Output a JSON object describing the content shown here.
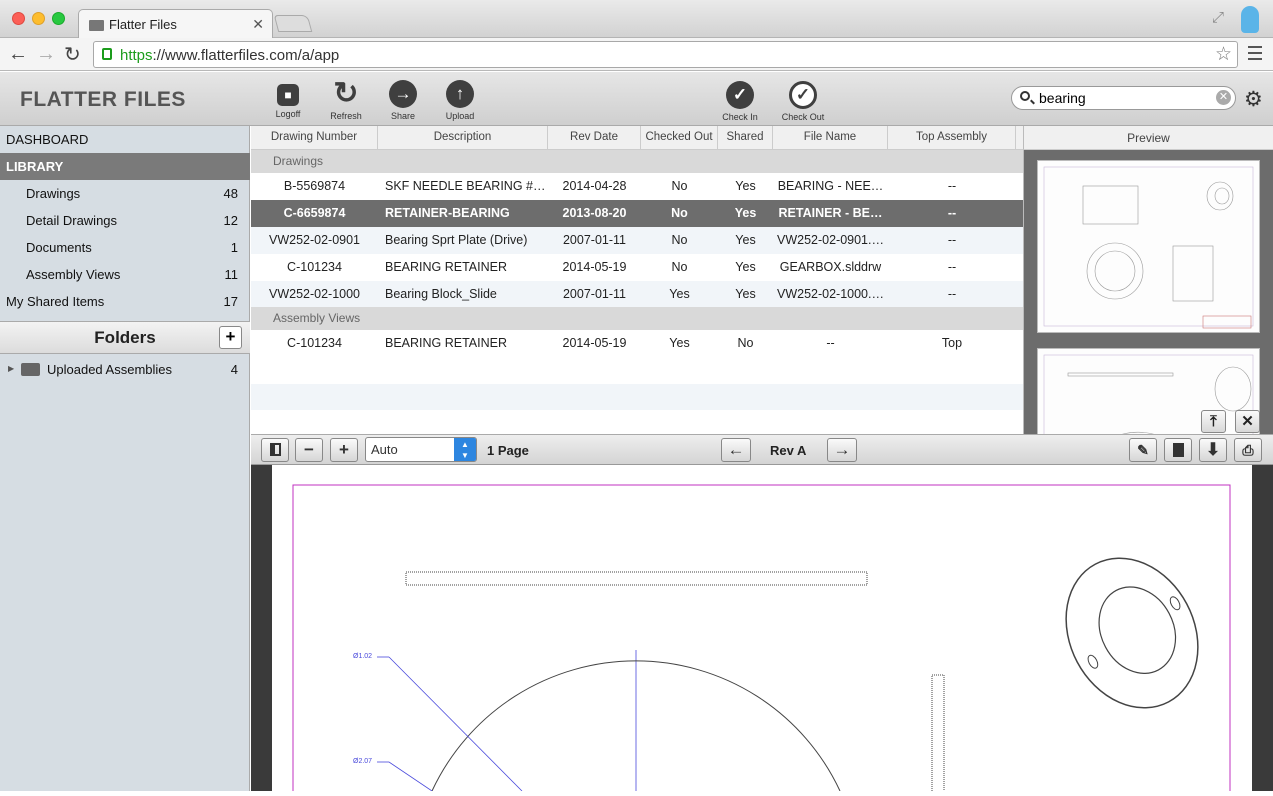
{
  "browser": {
    "tab_title": "Flatter Files",
    "url_https": "https",
    "url_rest": "://www.flatterfiles.com/a/app"
  },
  "app": {
    "logo": "FLATTER FILES",
    "toolbar": {
      "logoff": "Logoff",
      "refresh": "Refresh",
      "share": "Share",
      "upload": "Upload",
      "check_in": "Check In",
      "check_out": "Check Out"
    },
    "search": {
      "value": "bearing"
    }
  },
  "sidebar": {
    "dashboard": "DASHBOARD",
    "library": "LIBRARY",
    "items": [
      {
        "label": "Drawings",
        "count": "48"
      },
      {
        "label": "Detail Drawings",
        "count": "12"
      },
      {
        "label": "Documents",
        "count": "1"
      },
      {
        "label": "Assembly Views",
        "count": "11"
      }
    ],
    "shared": {
      "label": "My Shared Items",
      "count": "17"
    },
    "folders_title": "Folders",
    "folders_add": "+",
    "folders": [
      {
        "label": "Uploaded Assemblies",
        "count": "4"
      }
    ]
  },
  "table": {
    "headers": [
      "Drawing Number",
      "Description",
      "Rev Date",
      "Checked Out",
      "Shared",
      "File Name",
      "Top Assembly"
    ],
    "groups": [
      "Drawings",
      "Assembly Views"
    ],
    "drawings": [
      [
        "B-5569874",
        "SKF NEEDLE BEARING #…",
        "2014-04-28",
        "No",
        "Yes",
        "BEARING - NEE…",
        "--"
      ],
      [
        "C-6659874",
        "RETAINER-BEARING",
        "2013-08-20",
        "No",
        "Yes",
        "RETAINER - BE…",
        "--"
      ],
      [
        "VW252-02-0901",
        "Bearing Sprt  Plate (Drive)",
        "2007-01-11",
        "No",
        "Yes",
        "VW252-02-0901.…",
        "--"
      ],
      [
        "C-101234",
        "BEARING RETAINER",
        "2014-05-19",
        "No",
        "Yes",
        "GEARBOX.slddrw",
        "--"
      ],
      [
        "VW252-02-1000",
        "Bearing Block_Slide",
        "2007-01-11",
        "Yes",
        "Yes",
        "VW252-02-1000.…",
        "--"
      ]
    ],
    "assembly_views": [
      [
        "C-101234",
        "BEARING RETAINER",
        "2014-05-19",
        "Yes",
        "No",
        "--",
        "Top"
      ]
    ]
  },
  "preview": {
    "title": "Preview"
  },
  "viewer": {
    "zoom": "Auto",
    "pages": "1 Page",
    "rev": "Rev A",
    "dim1": "Ø1.02",
    "dim2": "Ø2.07"
  },
  "colors": {
    "selected_row": "#6d6d6d",
    "sidebar_bg": "#d6dde3",
    "zoom_arrow": "#2d86e0"
  }
}
